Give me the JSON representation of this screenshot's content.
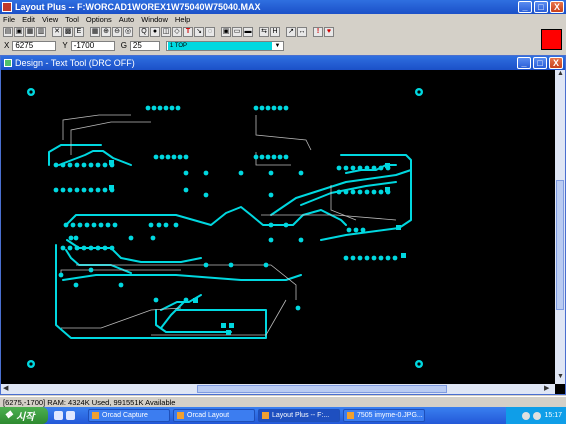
{
  "window": {
    "title": "Layout Plus -- F:WORCAD1WOREX1W75040W75040.MAX",
    "minimize": "_",
    "maximize": "□",
    "close": "X"
  },
  "menu": [
    "File",
    "Edit",
    "View",
    "Tool",
    "Options",
    "Auto",
    "Window",
    "Help"
  ],
  "coords": {
    "x_label": "X",
    "x_value": "6275",
    "y_label": "Y",
    "y_value": "-1700",
    "g_label": "G",
    "g_value": "25",
    "layer": "1 TOP",
    "current_color": "#ff0000"
  },
  "design": {
    "title": "Design - Text Tool (DRC OFF)",
    "trace_color": "#00d8e0"
  },
  "status": "[6275,-1700]   RAM: 4324K Used, 991551K Available",
  "taskbar": {
    "start": "시작",
    "tasks": [
      "Orcad Capture",
      "Orcad Layout",
      "Layout Plus -- F:...",
      "7505 imyme-0.JPG..."
    ],
    "clock": "15:17"
  }
}
